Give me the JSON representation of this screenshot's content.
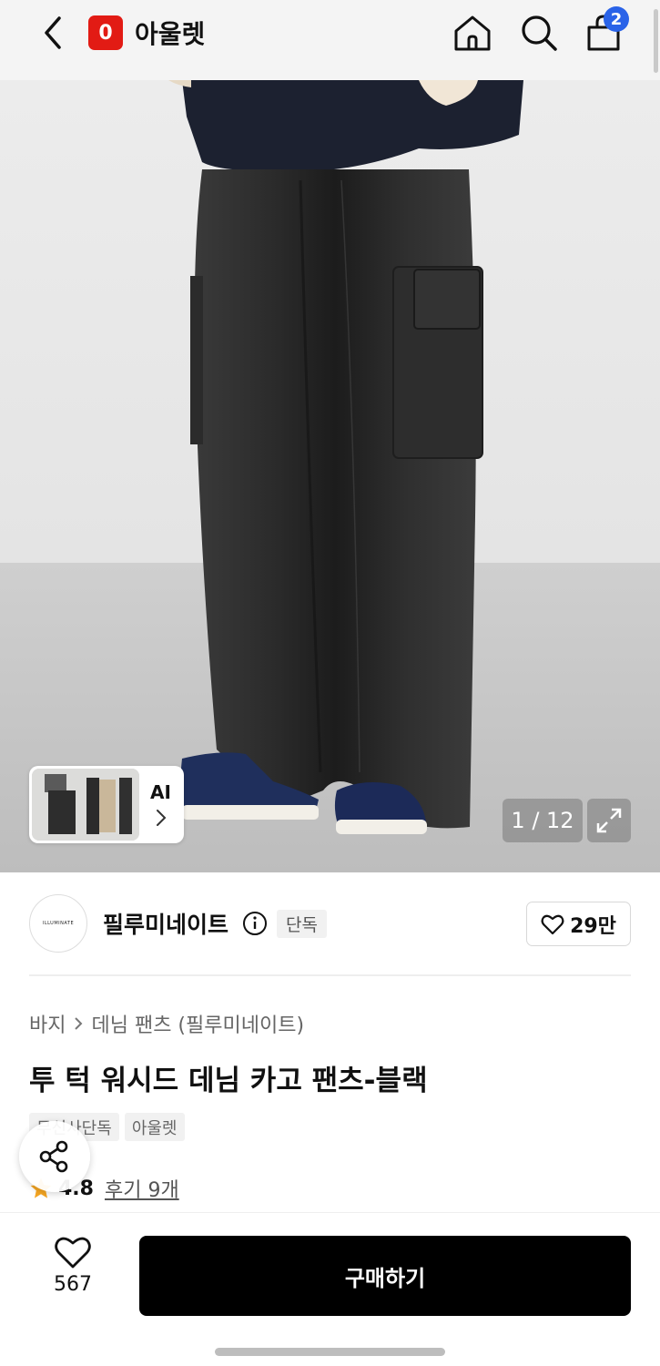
{
  "header": {
    "logo_letter": "0",
    "app_name": "아울렛",
    "cart_count": "2",
    "brand_color": "#e21b14",
    "badge_color": "#2a63e8",
    "icons": [
      "back-icon",
      "home-icon",
      "search-icon",
      "shopping-bag-icon"
    ]
  },
  "gallery": {
    "thumb_label": "AI",
    "pager": "1 / 12"
  },
  "brand": {
    "logo_text": "ILLUMINATE",
    "name": "필루미네이트",
    "badge": "단독",
    "like_count": "29만"
  },
  "product": {
    "breadcrumb": [
      "바지",
      "데님 팬츠 (필루미네이트)"
    ],
    "title": "투 턱 워시드 데님 카고 팬츠-블랙",
    "tags": [
      "무신사단독",
      "아울렛"
    ],
    "rating": "4.8",
    "review_link": "후기 9개",
    "rating_color": "#f5a623"
  },
  "bottom": {
    "wish_count": "567",
    "buy_label": "구매하기"
  }
}
